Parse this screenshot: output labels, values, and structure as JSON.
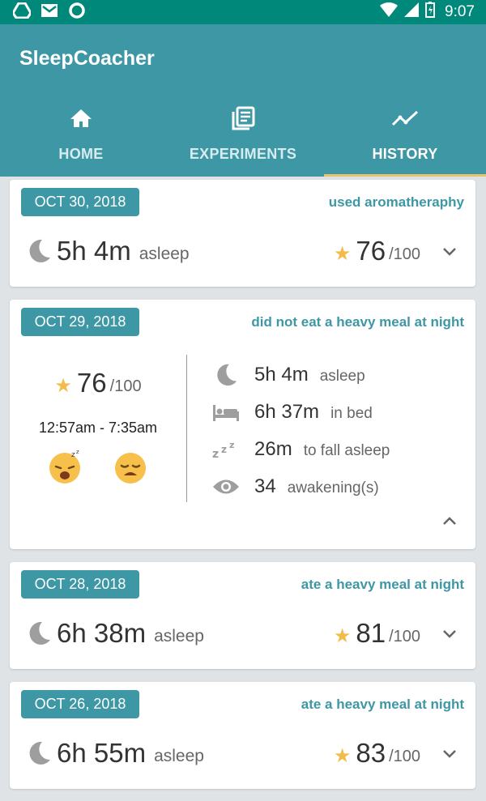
{
  "status_bar": {
    "time": "9:07",
    "icons": [
      "drive-icon",
      "gmail-icon",
      "sync-circle-icon",
      "wifi-icon",
      "signal-icon",
      "battery-icon"
    ]
  },
  "app": {
    "title": "SleepCoacher"
  },
  "tabs": [
    {
      "label": "HOME",
      "icon": "home-icon",
      "active": false
    },
    {
      "label": "EXPERIMENTS",
      "icon": "experiments-icon",
      "active": false
    },
    {
      "label": "HISTORY",
      "icon": "trend-line-icon",
      "active": true
    }
  ],
  "colors": {
    "primary": "#3d97a4",
    "status_bar": "#00897b",
    "accent": "#e8c16a",
    "star": "#f2bb4a"
  },
  "cards": [
    {
      "date": "OCT 30, 2018",
      "experiment": "used aromatheraphy",
      "duration": "5h 4m",
      "duration_unit": "asleep",
      "score": "76",
      "score_max": "/100",
      "expanded": false
    },
    {
      "date": "OCT 29, 2018",
      "experiment": "did not eat a heavy meal at night",
      "score": "76",
      "score_max": "/100",
      "time_range": "12:57am - 7:35am",
      "expanded": true,
      "face_icons": [
        "sleepy-face-icon",
        "tired-face-icon"
      ],
      "stats": [
        {
          "icon": "moon-icon",
          "value": "5h 4m",
          "label": "asleep"
        },
        {
          "icon": "bed-icon",
          "value": "6h 37m",
          "label": "in bed"
        },
        {
          "icon": "zzz-icon",
          "value": "26m",
          "label": "to fall asleep"
        },
        {
          "icon": "eye-icon",
          "value": "34",
          "label": "awakening(s)"
        }
      ]
    },
    {
      "date": "OCT 28, 2018",
      "experiment": "ate a heavy meal at night",
      "duration": "6h 38m",
      "duration_unit": "asleep",
      "score": "81",
      "score_max": "/100",
      "expanded": false
    },
    {
      "date": "OCT 26, 2018",
      "experiment": "ate a heavy meal at night",
      "duration": "6h 55m",
      "duration_unit": "asleep",
      "score": "83",
      "score_max": "/100",
      "expanded": false
    }
  ]
}
